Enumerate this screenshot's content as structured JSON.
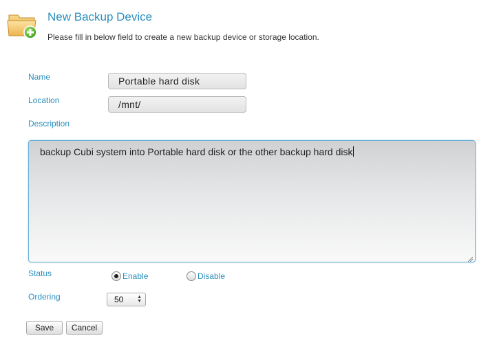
{
  "header": {
    "title": "New Backup Device",
    "subtitle": "Please fill in below field to create a new backup device or storage location."
  },
  "form": {
    "name_label": "Name",
    "name_value": "Portable hard disk",
    "location_label": "Location",
    "location_value": "/mnt/",
    "description_label": "Description",
    "description_value": "backup Cubi system into Portable hard disk or the other backup hard disk",
    "status_label": "Status",
    "status_options": [
      {
        "label": "Enable",
        "selected": true
      },
      {
        "label": "Disable",
        "selected": false
      }
    ],
    "ordering_label": "Ordering",
    "ordering_value": "50"
  },
  "buttons": {
    "save_label": "Save",
    "cancel_label": "Cancel"
  },
  "colors": {
    "label": "#2a8fbd",
    "title": "#2a8fbd",
    "focus_border": "#6ab2d9"
  },
  "icons": {
    "header": "folder-add-icon",
    "resize": "resize-grip-icon",
    "select_arrows": "up-down-arrows-icon"
  }
}
